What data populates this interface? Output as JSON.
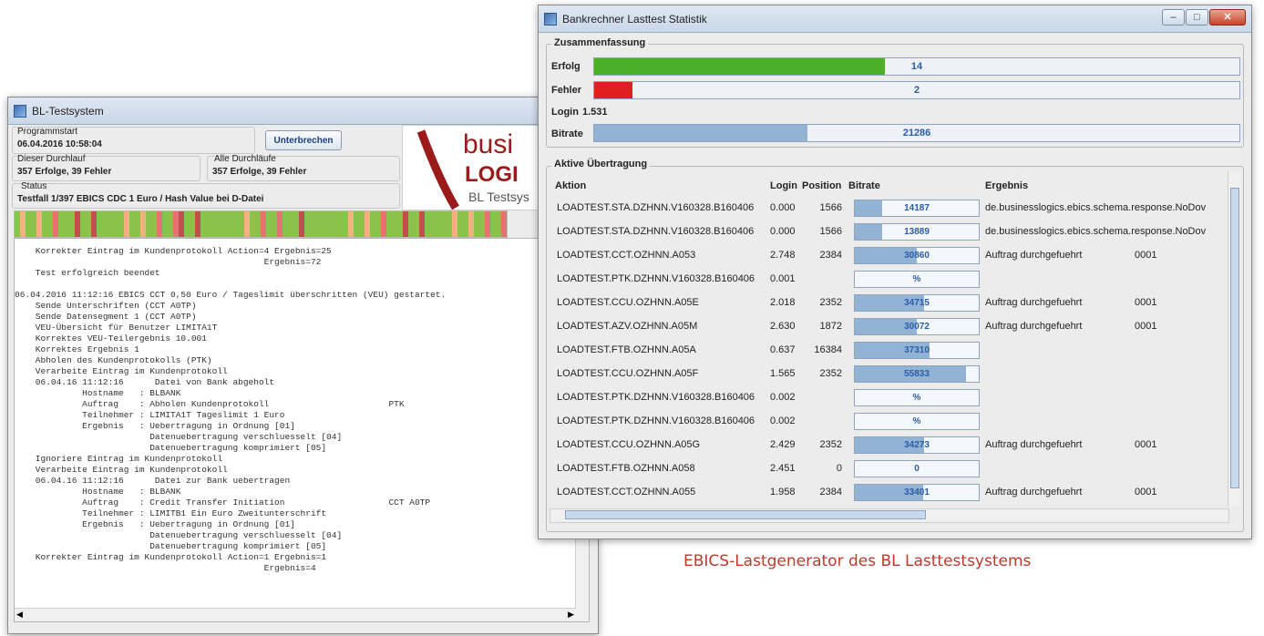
{
  "left_window": {
    "title": "BL-Testsystem",
    "programmstart_label": "Programmstart",
    "programmstart_value": "06.04.2016 10:58:04",
    "interrupt_button": "Unterbrechen",
    "dieser_label": "Dieser Durchlauf",
    "dieser_value": "357 Erfolge, 39 Fehler",
    "alle_label": "Alle Durchläufe",
    "alle_value": "357 Erfolge, 39 Fehler",
    "status_label": "Status",
    "status_value": "Testfall 1/397 EBICS CDC 1 Euro / Hash Value bei D-Datei",
    "logo_text_1": "busi",
    "logo_text_2": "LOGI",
    "logo_text_3": "BL Testsys",
    "console_text": "    Korrekter Eintrag im Kundenprotokoll Action=4 Ergebnis=25\n                                                Ergebnis=72\n    Test erfolgreich beendet\n\n06.04.2016 11:12:16 EBICS CCT 0,50 Euro / Tageslimit überschritten (VEU) gestartet.\n    Sende Unterschriften (CCT A0TP)\n    Sende Datensegment 1 (CCT A0TP)\n    VEU-Übersicht für Benutzer LIMITA1T\n    Korrektes VEU-Teilergebnis 10.001\n    Korrektes Ergebnis 1\n    Abholen des Kundenprotokolls (PTK)\n    Verarbeite Eintrag im Kundenprotokoll\n    06.04.16 11:12:16      Datei von Bank abgeholt\n             Hostname   : BLBANK\n             Auftrag    : Abholen Kundenprotokoll                       PTK\n             Teilnehmer : LIMITA1T Tageslimit 1 Euro\n             Ergebnis   : Uebertragung in Ordnung [01]\n                          Datenuebertragung verschluesselt [04]\n                          Datenuebertragung komprimiert [05]\n    Ignoriere Eintrag im Kundenprotokoll\n    Verarbeite Eintrag im Kundenprotokoll\n    06.04.16 11:12:16      Datei zur Bank uebertragen\n             Hostname   : BLBANK\n             Auftrag    : Credit Transfer Initiation                    CCT A0TP\n             Teilnehmer : LIMITB1 Ein Euro Zweitunterschrift\n             Ergebnis   : Uebertragung in Ordnung [01]\n                          Datenuebertragung verschluesselt [04]\n                          Datenuebertragung komprimiert [05]\n    Korrekter Eintrag im Kundenprotokoll Action=1 Ergebnis=1\n                                                Ergebnis=4"
  },
  "right_window": {
    "title": "Bankrechner Lasttest Statistik",
    "summary_legend": "Zusammenfassung",
    "erfolg_label": "Erfolg",
    "erfolg_value": "14",
    "erfolg_fraction": 0.45,
    "fehler_label": "Fehler",
    "fehler_value": "2",
    "fehler_fraction": 0.06,
    "login_label": "Login",
    "login_value": "1.531",
    "bitrate_label": "Bitrate",
    "bitrate_value": "21286",
    "bitrate_fraction": 0.33,
    "active_legend": "Aktive Übertragung",
    "columns": {
      "aktion": "Aktion",
      "login": "Login",
      "position": "Position",
      "bitrate": "Bitrate",
      "ergebnis": "Ergebnis"
    },
    "rows": [
      {
        "aktion": "LOADTEST.STA.DZHNN.V160328.B160406",
        "login": "0.000",
        "position": "1566",
        "bitrate": "14187",
        "fill": 0.22,
        "ergebnis": "de.businesslogics.ebics.schema.response.NoDov",
        "code": ""
      },
      {
        "aktion": "LOADTEST.STA.DZHNN.V160328.B160406",
        "login": "0.000",
        "position": "1566",
        "bitrate": "13889",
        "fill": 0.22,
        "ergebnis": "de.businesslogics.ebics.schema.response.NoDov",
        "code": ""
      },
      {
        "aktion": "LOADTEST.CCT.OZHNN.A053",
        "login": "2.748",
        "position": "2384",
        "bitrate": "30860",
        "fill": 0.5,
        "ergebnis": "Auftrag durchgefuehrt",
        "code": "0001"
      },
      {
        "aktion": "LOADTEST.PTK.DZHNN.V160328.B160406",
        "login": "0.001",
        "position": "",
        "bitrate": "%",
        "fill": 0,
        "ergebnis": "",
        "code": ""
      },
      {
        "aktion": "LOADTEST.CCU.OZHNN.A05E",
        "login": "2.018",
        "position": "2352",
        "bitrate": "34715",
        "fill": 0.56,
        "ergebnis": "Auftrag durchgefuehrt",
        "code": "0001"
      },
      {
        "aktion": "LOADTEST.AZV.OZHNN.A05M",
        "login": "2.630",
        "position": "1872",
        "bitrate": "30072",
        "fill": 0.5,
        "ergebnis": "Auftrag durchgefuehrt",
        "code": "0001"
      },
      {
        "aktion": "LOADTEST.FTB.OZHNN.A05A",
        "login": "0.637",
        "position": "16384",
        "bitrate": "37310",
        "fill": 0.6,
        "ergebnis": "",
        "code": ""
      },
      {
        "aktion": "LOADTEST.CCU.OZHNN.A05F",
        "login": "1.565",
        "position": "2352",
        "bitrate": "55833",
        "fill": 0.9,
        "ergebnis": "",
        "code": ""
      },
      {
        "aktion": "LOADTEST.PTK.DZHNN.V160328.B160406",
        "login": "0.002",
        "position": "",
        "bitrate": "%",
        "fill": 0,
        "ergebnis": "",
        "code": ""
      },
      {
        "aktion": "LOADTEST.PTK.DZHNN.V160328.B160406",
        "login": "0.002",
        "position": "",
        "bitrate": "%",
        "fill": 0,
        "ergebnis": "",
        "code": ""
      },
      {
        "aktion": "LOADTEST.CCU.OZHNN.A05G",
        "login": "2.429",
        "position": "2352",
        "bitrate": "34273",
        "fill": 0.56,
        "ergebnis": "Auftrag durchgefuehrt",
        "code": "0001"
      },
      {
        "aktion": "LOADTEST.FTB.OZHNN.A058",
        "login": "2.451",
        "position": "0",
        "bitrate": "0",
        "fill": 0,
        "ergebnis": "",
        "code": ""
      },
      {
        "aktion": "LOADTEST.CCT.OZHNN.A055",
        "login": "1.958",
        "position": "2384",
        "bitrate": "33401",
        "fill": 0.55,
        "ergebnis": "Auftrag durchgefuehrt",
        "code": "0001"
      }
    ]
  },
  "caption": "EBICS-Lastgenerator des BL Lasttestsystems",
  "colors": {
    "success": "#4caf28",
    "error": "#e02020",
    "bitrate": "#93b3d4",
    "caption": "#c0392b"
  }
}
